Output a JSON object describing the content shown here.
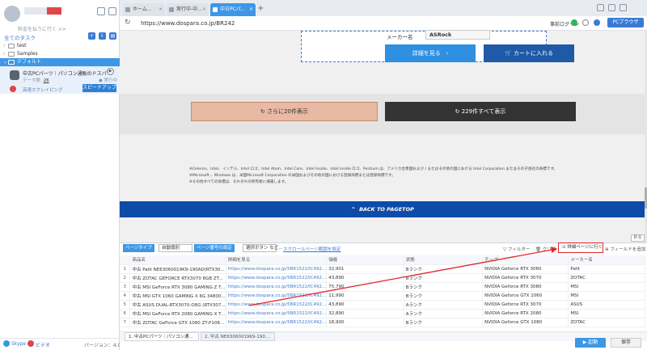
{
  "sidebar": {
    "subtitle": "料金を払うに行く >>",
    "all_tasks": "全てのタスク",
    "tree": [
      "test",
      "Samples",
      "デフォルト"
    ],
    "task": {
      "title": "中古PCパーツ｜パソコン通販のドスパラ【...",
      "data_label": "データ数",
      "data_count": "26",
      "status": "● 実行中",
      "speed_label": "高速スクレイピング",
      "speed_button": "スピードアップ"
    },
    "footer": {
      "skype": "Skype",
      "video": "ビデオ",
      "version": "バージョン：4.0.1"
    }
  },
  "browser": {
    "tabs": [
      {
        "label": "ホーム..."
      },
      {
        "label": "実行中-中..."
      },
      {
        "label": "中古PCパ..."
      }
    ],
    "url": "https://www.dospara.co.jp/BR242",
    "login": "事前ログイン",
    "pc_browser": "PCブラウザ"
  },
  "page": {
    "maker_label": "メーカー名",
    "maker_value": "ASRock",
    "detail_button": "詳細を見る",
    "cart_button": "カートに入れる",
    "more_button": "さらに20件表示",
    "all_button": "229件すべて表示",
    "notes": [
      "※Celeron、Intel、インテル、Intel ロゴ、Intel Atom、Intel Core、Intel Inside、Intel Inside ロゴ、Pentium は、アメリカ合衆国および / またはその他の国における Intel Corporation またはその子会社の商標です。",
      "※Microsoft 、Windows は、米国Microsoft Corporation の米国およびその他の国における登録商標または登録商標です。",
      "※その他すべての商標は、それぞれの所有者に帰属します。"
    ],
    "back_to_top": "BACK TO PAGETOP"
  },
  "panel": {
    "collapse": "折る",
    "page_type_label": "ページタイプ",
    "page_type_value": "自動識別",
    "page_setting_label": "ページ番号の設定",
    "select_button_value": "選択ボタン など...",
    "scroll_link": "スクロールページ範囲を設定",
    "filter": "フィルター",
    "clear": "クリア",
    "goto_detail": "詳細ページに行く",
    "add_field": "フィールドを追加",
    "columns": [
      "商品名",
      "詳細を見る",
      "価格",
      "状態",
      "チップ",
      "メーカー名"
    ],
    "rows": [
      [
        "1",
        "中古 Palit NE63060019K9-190AD(RTX30...",
        "https://www.dospara.co.jp/5BR1522/IC492...",
        "32,901",
        "Bランク",
        "NVIDIA Geforce RTX 3060",
        "Palit"
      ],
      [
        "2",
        "中古 ZOTAC GEFORCE RTX3070 8GB ZT...",
        "https://www.dospara.co.jp/5BR1522/IC492...",
        "43,890",
        "Bランク",
        "NVIDIA Geforce RTX 3070",
        "ZOTAC"
      ],
      [
        "3",
        "中古 MSI GeForce RTX 3080 GAMING Z T...",
        "https://www.dospara.co.jp/5BR1522/IC492...",
        "75,790",
        "Bランク",
        "NVIDIA Geforce RTX 3080",
        "MSI"
      ],
      [
        "4",
        "中古 MSI GTX 1060 GAMING X 6G 34800...",
        "https://www.dospara.co.jp/5BR1522/IC492...",
        "11,990",
        "Bランク",
        "NVIDIA Geforce GTX 1060",
        "MSI"
      ],
      [
        "5",
        "中古 ASUS DUAL-RTX3070-O8G (RTX307...",
        "https://www.dospara.co.jp/5BR1522/IC492...",
        "43,890",
        "Aランク",
        "NVIDIA Geforce RTX 3070",
        "ASUS"
      ],
      [
        "6",
        "中古 MSI GeForce RTX 2080 GAMING X T...",
        "https://www.dospara.co.jp/5BR1522/IC492...",
        "32,890",
        "Aランク",
        "NVIDIA Geforce RTX 2080",
        "MSI"
      ],
      [
        "7",
        "中古 ZOTAC GeForce GTX 1080 ZT-P108...",
        "https://www.dospara.co.jp/5BR1522/IC492...",
        "18,900",
        "Bランク",
        "NVIDIA Geforce GTX 1080",
        "ZOTAC"
      ]
    ],
    "task_tabs": [
      "1. 中古PCパーツ｜パソコン通...",
      "2. 中古 NE63060019K9-190..."
    ],
    "start": "▶ 起動",
    "save": "保存"
  },
  "colors": {
    "accent": "#3d97e6",
    "annotation_red": "#e0252a",
    "pagetop_blue": "#0e4aa8"
  }
}
